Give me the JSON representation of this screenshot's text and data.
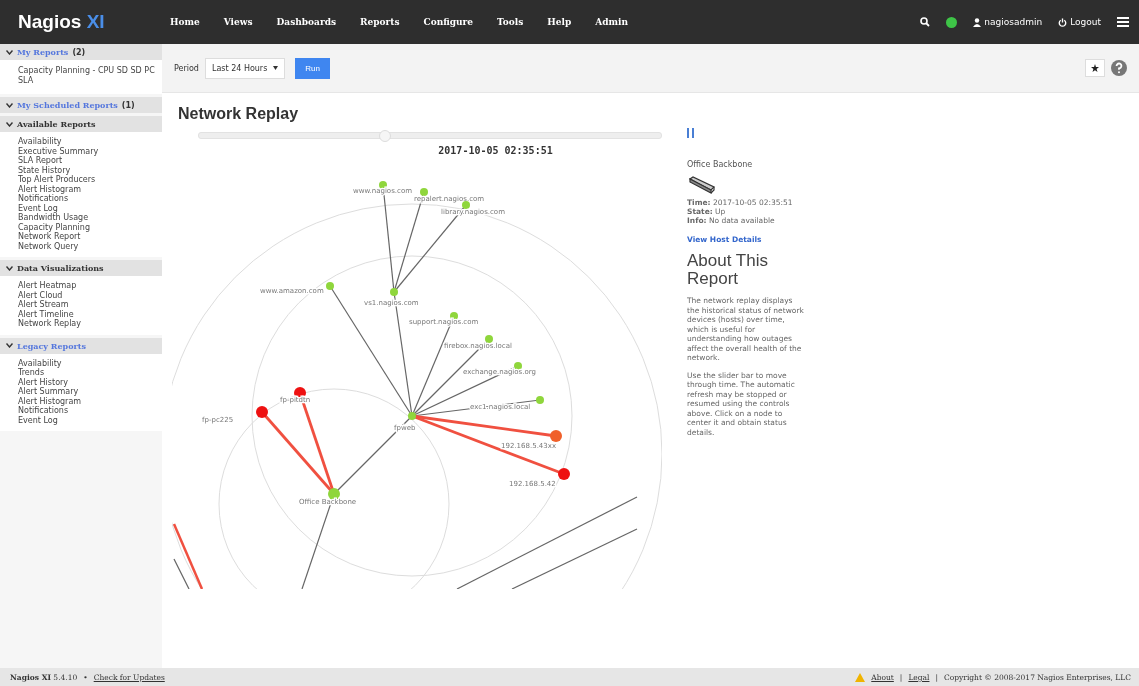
{
  "header": {
    "logo": "Nagios",
    "logo_suffix": "XI",
    "menu": [
      "Home",
      "Views",
      "Dashboards",
      "Reports",
      "Configure",
      "Tools",
      "Help",
      "Admin"
    ],
    "user": "nagiosadmin",
    "logout": "Logout"
  },
  "sidebar": [
    {
      "title": "My Reports",
      "count": "(2)",
      "link": true,
      "items": [
        "Capacity Planning - CPU SD SD PC SLA"
      ]
    },
    {
      "title": "My Scheduled Reports",
      "count": "(1)",
      "link": true
    },
    {
      "title": "Available Reports",
      "link": false,
      "items": [
        "Availability",
        "Executive Summary",
        "SLA Report",
        "State History",
        "Top Alert Producers",
        "Alert Histogram",
        "Notifications",
        "Event Log",
        "Bandwidth Usage",
        "Capacity Planning",
        "Network Report",
        "Network Query"
      ]
    },
    {
      "title": "Data Visualizations",
      "link": false,
      "items": [
        "Alert Heatmap",
        "Alert Cloud",
        "Alert Stream",
        "Alert Timeline",
        "Network Replay"
      ]
    },
    {
      "title": "Legacy Reports",
      "link": true,
      "items": [
        "Availability",
        "Trends",
        "Alert History",
        "Alert Summary",
        "Alert Histogram",
        "Notifications",
        "Event Log"
      ]
    }
  ],
  "toolbar": {
    "period_label": "Period",
    "period": "Last 24 Hours",
    "run": "Run"
  },
  "page_title": "Network Replay",
  "timeline": {
    "level": 0.4,
    "timestamp": "2017-10-05 02:35:51"
  },
  "graph": {
    "nodes": [
      {
        "name": "www.nagios.com",
        "color": "#8fd63c"
      },
      {
        "name": "repalert.nagios.com",
        "color": "#8fd63c"
      },
      {
        "name": "library.nagios.com",
        "color": "#8fd63c"
      },
      {
        "name": "www.amazon.com",
        "color": "#8fd63c"
      },
      {
        "name": "vs1.nagios.com",
        "color": "#8fd63c"
      },
      {
        "name": "support.nagios.com",
        "color": "#8fd63c"
      },
      {
        "name": "firebox.nagios.local",
        "color": "#8fd63c"
      },
      {
        "name": "exchange.nagios.org",
        "color": "#8fd63c"
      },
      {
        "name": "exc1.nagios.local",
        "color": "#8fd63c"
      },
      {
        "name": "fpweb",
        "color": "#8fd63c"
      },
      {
        "name": "192.168.5.43xx",
        "color": "#f0602a"
      },
      {
        "name": "192.168.5.42",
        "color": "#ee1111"
      },
      {
        "name": "fp-pitdtn",
        "color": "#ee1111"
      },
      {
        "name": "fp-pc225",
        "color": "#ee1111"
      },
      {
        "name": "Office Backbone",
        "color": "#8fd63c"
      }
    ],
    "edges": [
      {
        "color": "#666666"
      },
      {
        "color": "#666666"
      },
      {
        "color": "#666666"
      },
      {
        "color": "#666666"
      },
      {
        "color": "#666666"
      },
      {
        "color": "#666666"
      },
      {
        "color": "#666666"
      },
      {
        "color": "#666666"
      },
      {
        "color": "#666666"
      },
      {
        "color": "#f05040"
      },
      {
        "color": "#f05040"
      },
      {
        "color": "#666666"
      },
      {
        "color": "#f05040"
      },
      {
        "color": "#f05040"
      }
    ]
  },
  "details": {
    "host": "Office Backbone",
    "lines": [
      "**Time:** 2017-10-05 02:35:51",
      "**State:** Up",
      "**Info:** No data available"
    ],
    "link": "View Host Details"
  },
  "about": {
    "title": "About This Report",
    "paragraphs": [
      "The network replay displays the historical status of network devices (hosts) over time, which is useful for understanding how outages affect the overall health of the network.",
      "Use the slider bar to move through time. The automatic refresh may be stopped or resumed using the controls above. Click on a node to center it and obtain status details."
    ]
  },
  "footer": {
    "version": "**Nagios XI** 5.4.10",
    "separator": "•",
    "updates": "Check for Updates",
    "links": [
      "About",
      "Legal"
    ],
    "divider": "|",
    "copyright": "Copyright © 2008-2017 Nagios Enterprises, LLC"
  }
}
